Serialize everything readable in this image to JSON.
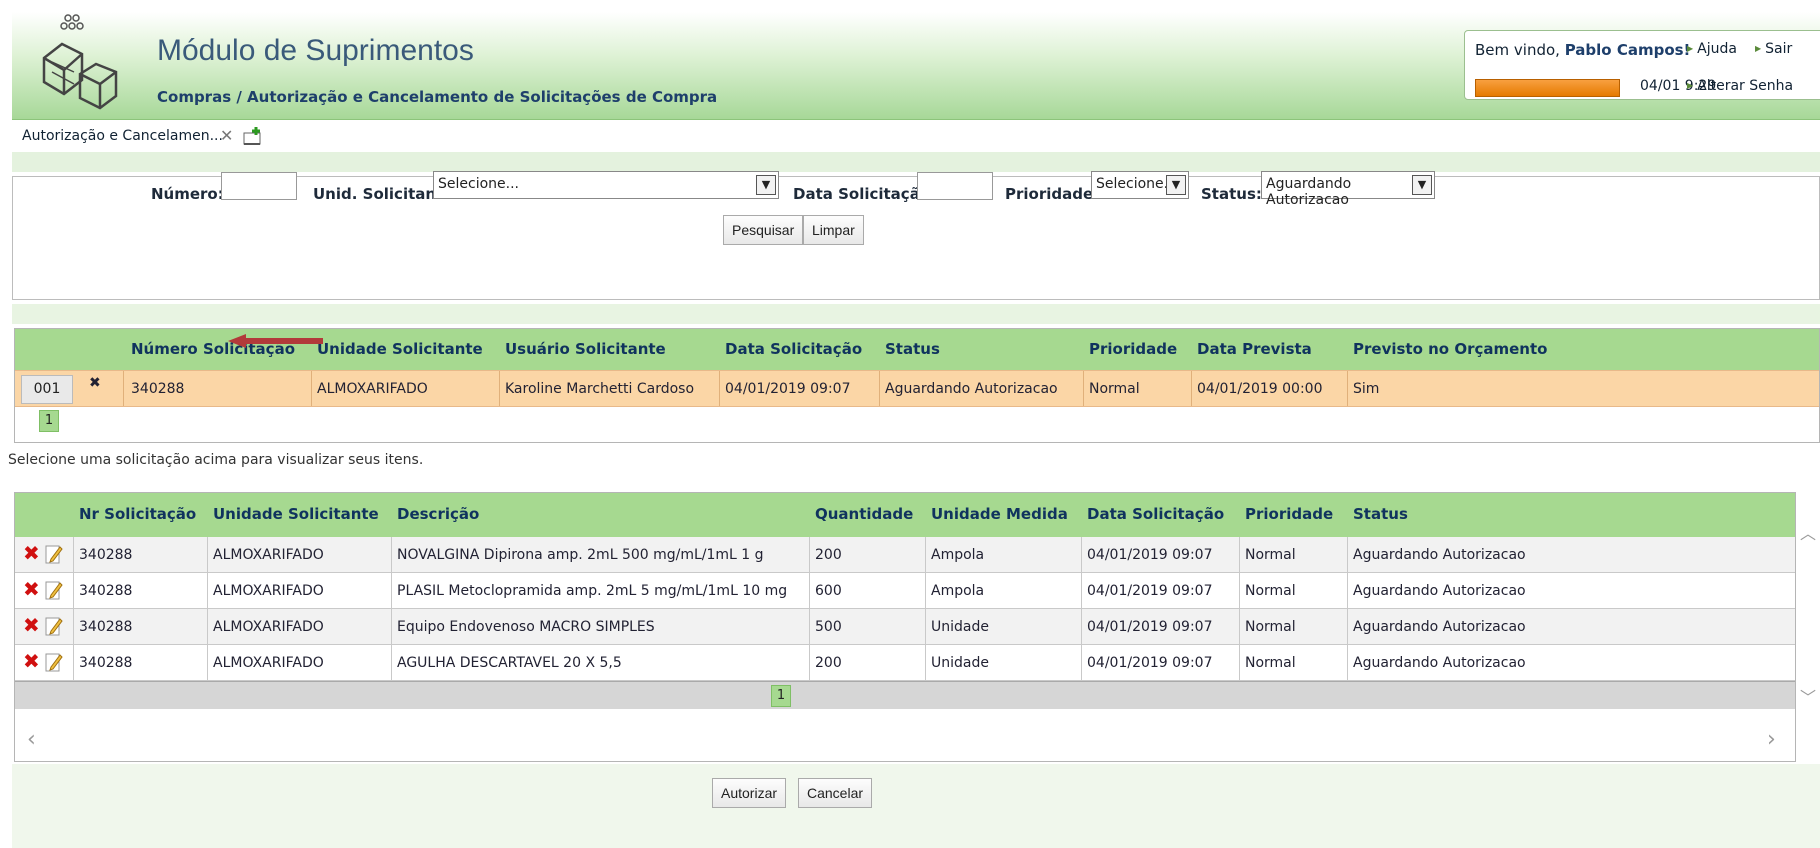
{
  "header": {
    "title": "Módulo de Suprimentos",
    "subtitle": "Compras / Autorização e Cancelamento de Solicitações de Compra",
    "welcome_prefix": "Bem vindo,",
    "user_name": "Pablo Campos!",
    "datetime": "04/01  9:29",
    "links": {
      "help": "Ajuda",
      "exit": "Sair",
      "change_password": "Alterar Senha"
    },
    "progress_color": "#f08a10"
  },
  "tabs": [
    {
      "label": "Autorização e Cancelamen..."
    }
  ],
  "search": {
    "numero_label": "Número:",
    "numero_value": "",
    "unidade_label": "Unid. Solicitante:",
    "unidade_value": "Selecione...",
    "data_label": "Data Solicitação:",
    "data_value": "",
    "prioridade_label": "Prioridade:",
    "prioridade_value": "Selecione...",
    "status_label": "Status:",
    "status_value": "Aguardando Autorizacao",
    "search_button": "Pesquisar",
    "clear_button": "Limpar"
  },
  "requests_grid": {
    "columns": [
      "Número Solicitação",
      "Unidade Solicitante",
      "Usuário Solicitante",
      "Data Solicitação",
      "Status",
      "Prioridade",
      "Data Prevista",
      "Previsto no Orçamento"
    ],
    "rows": [
      {
        "index": "001",
        "numero": "340288",
        "unidade": "ALMOXARIFADO",
        "usuario": "Karoline Marchetti Cardoso",
        "data": "04/01/2019 09:07",
        "status": "Aguardando Autorizacao",
        "prioridade": "Normal",
        "prevista": "04/01/2019 00:00",
        "orcamento": "Sim"
      }
    ],
    "page": "1",
    "selected_row_color": "#fbd6a6"
  },
  "hint": "Selecione uma solicitação acima para visualizar seus itens.",
  "items_grid": {
    "columns": [
      "Nr Solicitação",
      "Unidade Solicitante",
      "Descrição",
      "Quantidade",
      "Unidade Medida",
      "Data Solicitação",
      "Prioridade",
      "Status"
    ],
    "rows": [
      {
        "nr": "340288",
        "unidade": "ALMOXARIFADO",
        "descricao": "NOVALGINA Dipirona amp. 2mL 500 mg/mL/1mL 1 g",
        "quantidade": "200",
        "medida": "Ampola",
        "data": "04/01/2019 09:07",
        "prioridade": "Normal",
        "status": "Aguardando Autorizacao"
      },
      {
        "nr": "340288",
        "unidade": "ALMOXARIFADO",
        "descricao": "PLASIL Metoclopramida amp. 2mL 5 mg/mL/1mL 10 mg",
        "quantidade": "600",
        "medida": "Ampola",
        "data": "04/01/2019 09:07",
        "prioridade": "Normal",
        "status": "Aguardando Autorizacao"
      },
      {
        "nr": "340288",
        "unidade": "ALMOXARIFADO",
        "descricao": "Equipo Endovenoso MACRO SIMPLES",
        "quantidade": "500",
        "medida": "Unidade",
        "data": "04/01/2019 09:07",
        "prioridade": "Normal",
        "status": "Aguardando Autorizacao"
      },
      {
        "nr": "340288",
        "unidade": "ALMOXARIFADO",
        "descricao": "AGULHA DESCARTAVEL 20 X 5,5",
        "quantidade": "200",
        "medida": "Unidade",
        "data": "04/01/2019 09:07",
        "prioridade": "Normal",
        "status": "Aguardando Autorizacao"
      }
    ],
    "page": "1"
  },
  "actions": {
    "authorize": "Autorizar",
    "cancel": "Cancelar"
  },
  "theme": {
    "header_green": "#a6d990",
    "header_text": "#10335e",
    "delete_red": "#d01010"
  }
}
